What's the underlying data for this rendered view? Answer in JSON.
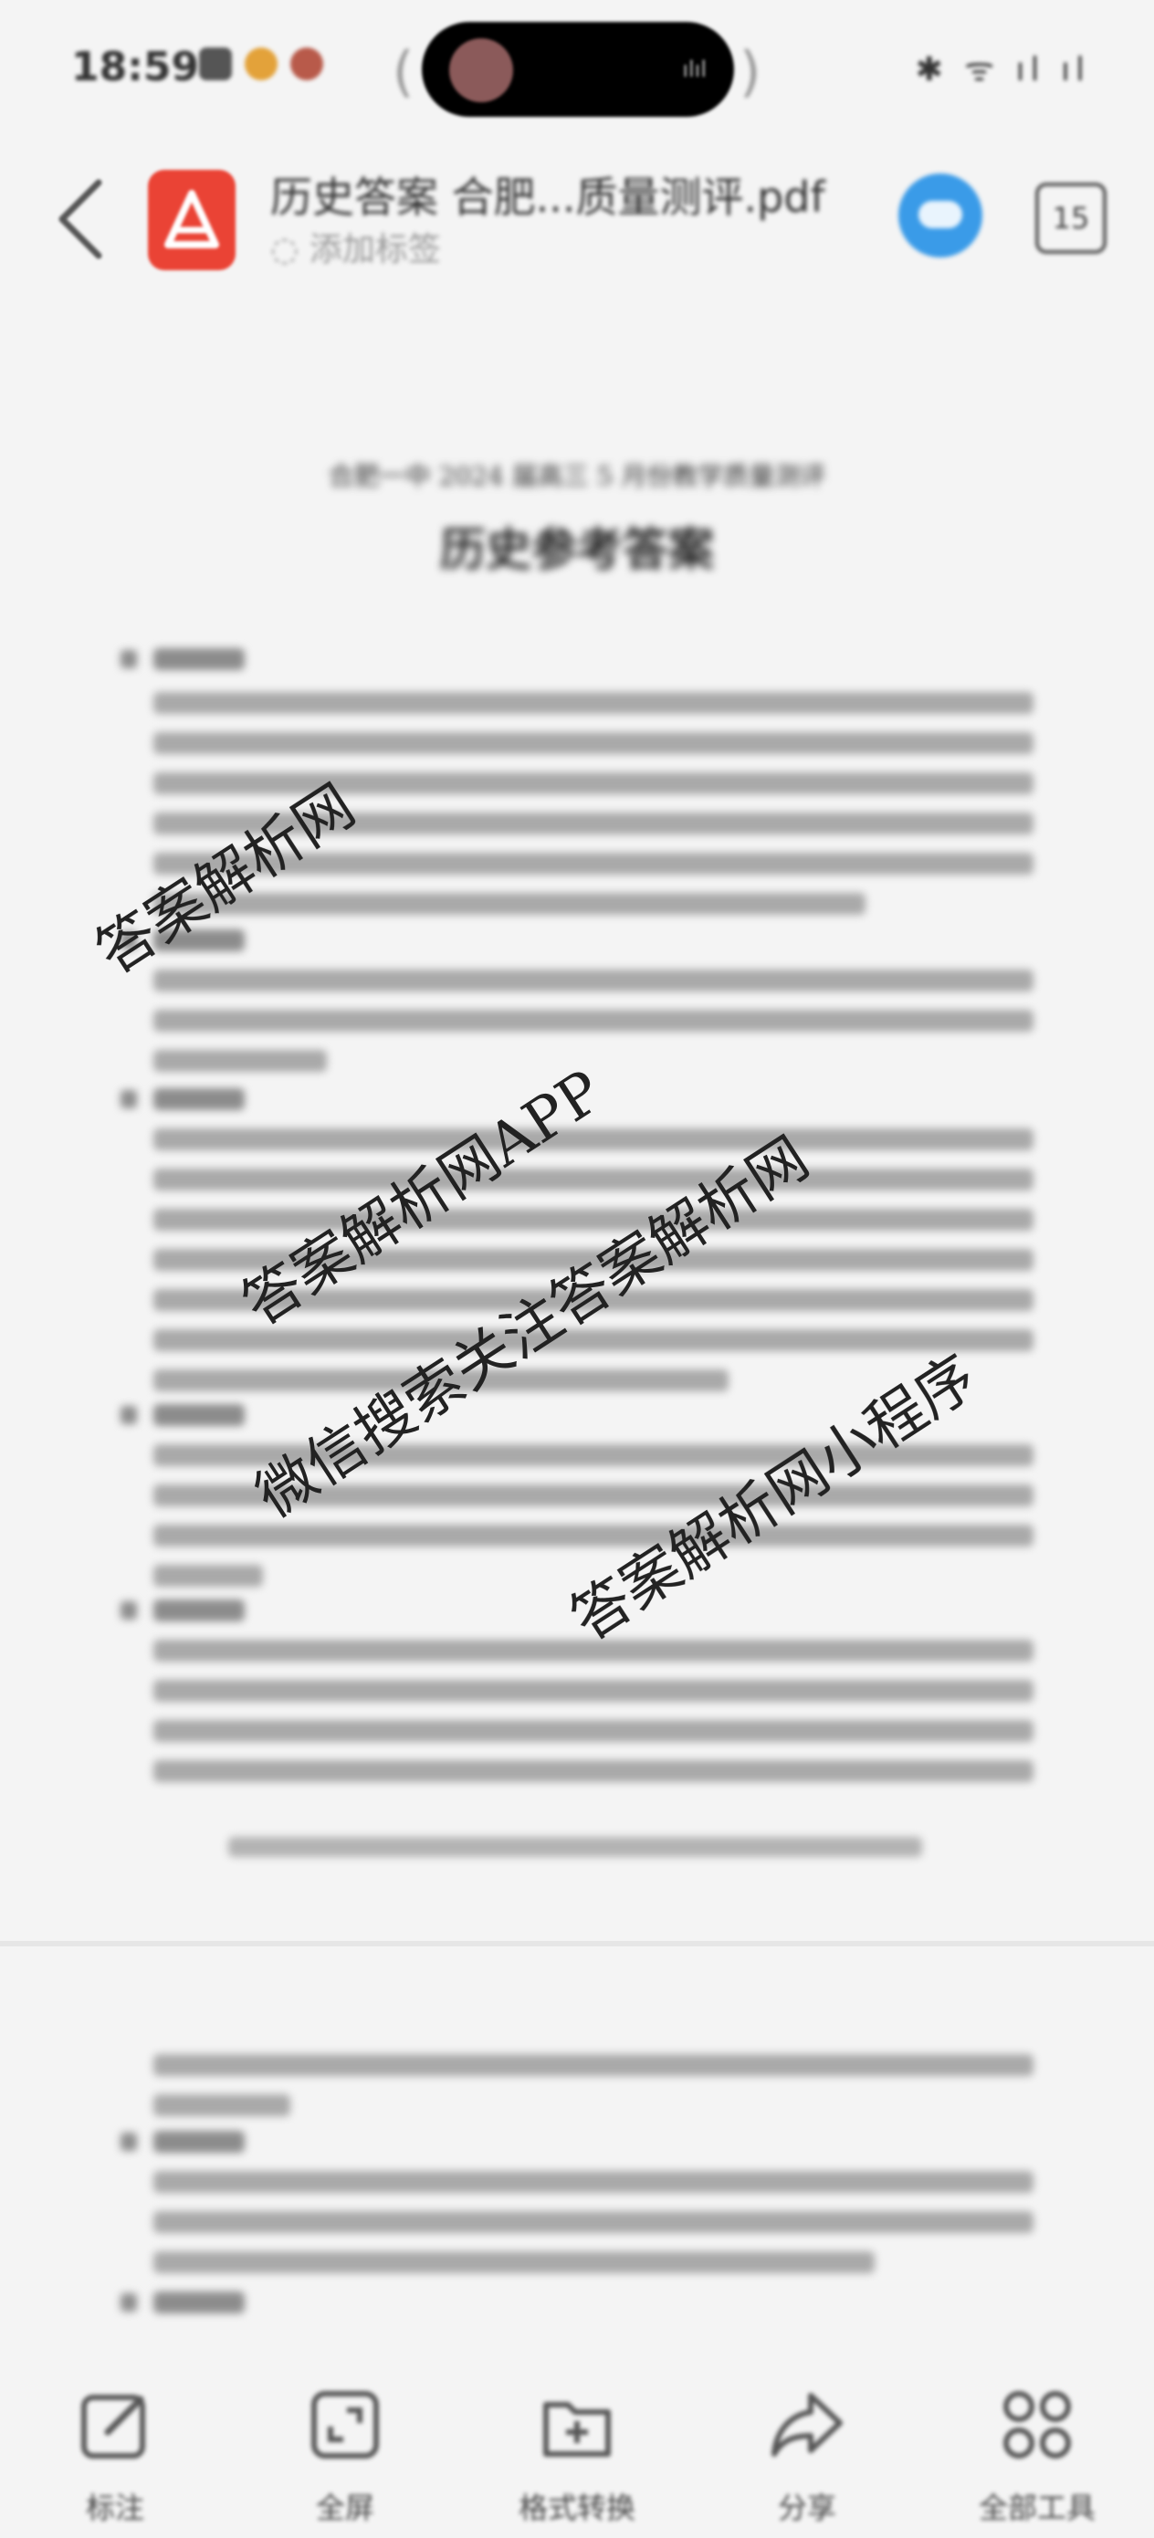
{
  "status_bar": {
    "time": "18:59",
    "right_icons": "✱ ᯤ ıl ıl"
  },
  "header": {
    "file_title": "历史答案 合肥...质量测评.pdf",
    "tag_label": "添加标签",
    "page_count": "15"
  },
  "document": {
    "subtitle": "合肥一中 2024 届高三 5 月份教学质量测评",
    "title": "历史参考答案"
  },
  "watermark": {
    "lines": [
      "答案解析网",
      "答案解析网APP",
      "微信搜索关注答案解析网",
      "答案解析网小程序"
    ]
  },
  "toolbar": {
    "items": [
      {
        "label": "标注",
        "icon": "annotate-icon"
      },
      {
        "label": "全屏",
        "icon": "fullscreen-icon"
      },
      {
        "label": "格式转换",
        "icon": "format-convert-icon"
      },
      {
        "label": "分享",
        "icon": "share-icon"
      },
      {
        "label": "全部工具",
        "icon": "all-tools-icon"
      }
    ]
  },
  "colors": {
    "background": "#f4f4f4",
    "pdf_icon": "#ea4335",
    "cloud_icon": "#3a9be8",
    "text": "#222222"
  }
}
